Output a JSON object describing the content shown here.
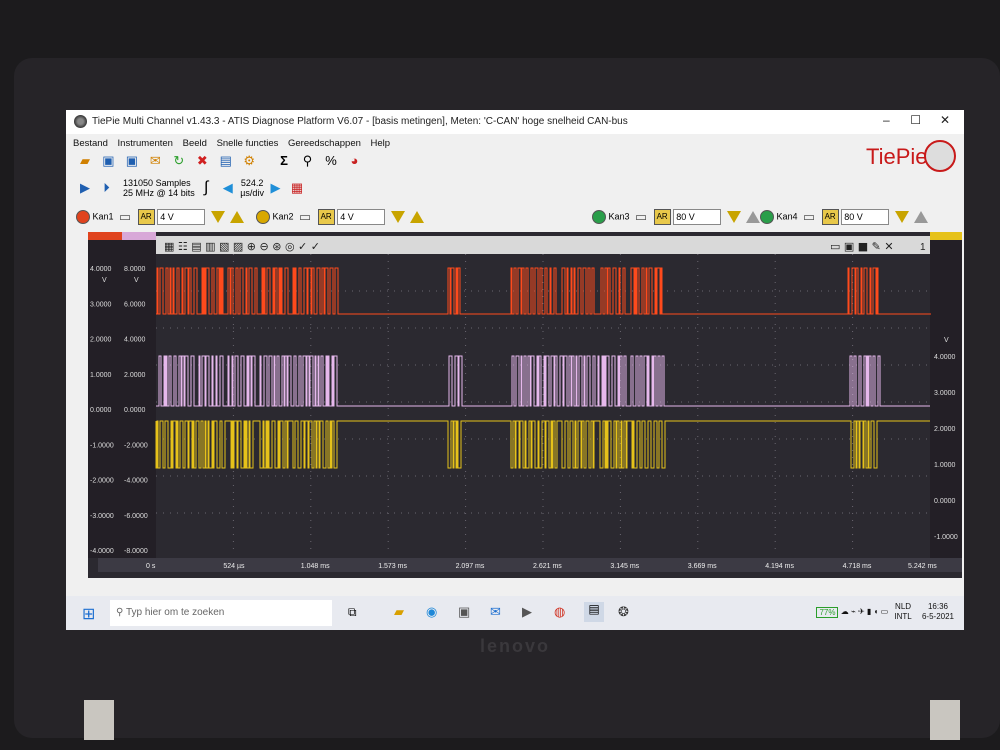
{
  "window": {
    "title": "TiePie Multi Channel v1.43.3 - ATIS Diagnose Platform V6.07 - [basis metingen], Meten: 'C-CAN' hoge snelheid CAN-bus"
  },
  "menu": [
    "Bestand",
    "Instrumenten",
    "Beeld",
    "Snelle functies",
    "Gereedschappen",
    "Help"
  ],
  "logo_text": "TiePie",
  "acq": {
    "samples": "131050 Samples",
    "rate": "25 MHz @ 14 bits",
    "timebase": "524.2",
    "timebase_unit": "µs/div"
  },
  "channels": [
    {
      "name": "Kan1",
      "range": "4 V",
      "color": "#e0431e"
    },
    {
      "name": "Kan2",
      "range": "4 V",
      "color": "#d8a8d8"
    },
    {
      "name": "Kan3",
      "range": "80 V",
      "color": "#2a9e4a"
    },
    {
      "name": "Kan4",
      "range": "80 V",
      "color": "#2a9e4a"
    }
  ],
  "ar_label": "AR",
  "axis_left1": [
    "4.0000",
    "3.0000",
    "2.0000",
    "1.0000",
    "0.0000",
    "-1.0000",
    "-2.0000",
    "-3.0000",
    "-4.0000"
  ],
  "axis_left2": [
    "8.0000",
    "6.0000",
    "4.0000",
    "2.0000",
    "0.0000",
    "-2.0000",
    "-4.0000",
    "-6.0000",
    "-8.0000"
  ],
  "axis_right": [
    "4.0000",
    "3.0000",
    "2.0000",
    "1.0000",
    "0.0000",
    "-1.0000"
  ],
  "unit_v": "V",
  "time_ticks": [
    "0 s",
    "524 µs",
    "1.048 ms",
    "1.573 ms",
    "2.097 ms",
    "2.621 ms",
    "3.145 ms",
    "3.669 ms",
    "4.194 ms",
    "4.718 ms",
    "5.242 ms"
  ],
  "cursor_count": "1",
  "taskbar": {
    "search_placeholder": "Typ hier om te zoeken",
    "battery": "77%",
    "lang1": "NLD",
    "lang2": "INTL",
    "time": "16:36",
    "date": "6-5-2021"
  },
  "laptop_brand": "lenovo",
  "colors": {
    "ch1": "#ff4a1c",
    "ch2": "#e6b8ec",
    "ch3": "#e6c21a",
    "bg": "#2b2930"
  }
}
